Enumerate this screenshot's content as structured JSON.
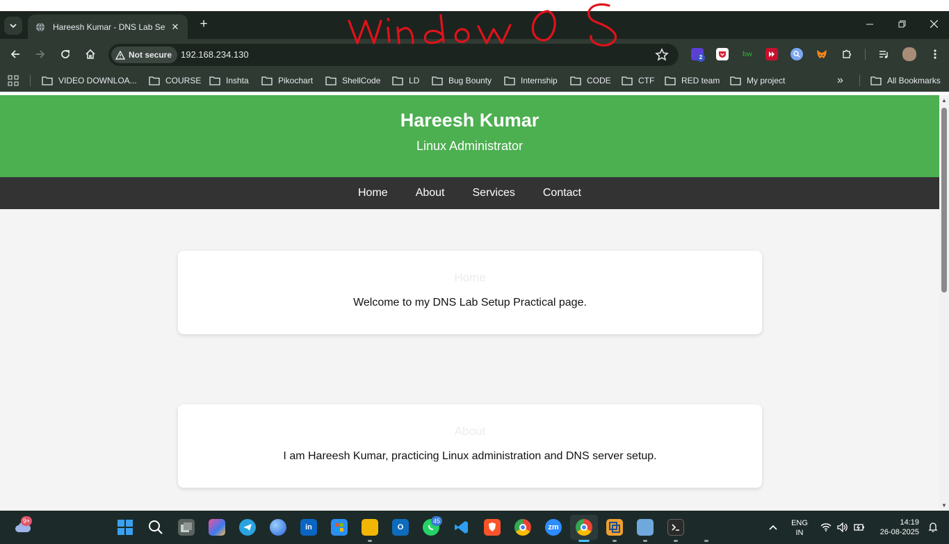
{
  "browser": {
    "tab_title": "Hareesh Kumar - DNS Lab Setup",
    "new_tab_symbol": "+",
    "close_tab_symbol": "✕",
    "security_label": "Not secure",
    "url": "192.168.234.130",
    "extension_badge": "2",
    "extension_text": "bw"
  },
  "annotation": {
    "text": "window OS",
    "color": "#e0121b"
  },
  "bookmarks": {
    "items": [
      "VIDEO DOWNLOA...",
      "COURSE",
      "Inshta",
      "Pikochart",
      "ShellCode",
      "LD",
      "Bug Bounty",
      "Internship",
      "CODE",
      "CTF",
      "RED team",
      "My project"
    ],
    "more_symbol": "»",
    "all_bookmarks": "All Bookmarks"
  },
  "site": {
    "title": "Hareesh Kumar",
    "subtitle": "Linux Administrator",
    "nav": [
      "Home",
      "About",
      "Services",
      "Contact"
    ],
    "sections": [
      {
        "heading": "Home",
        "text": "Welcome to my DNS Lab Setup Practical page."
      },
      {
        "heading": "About",
        "text": "I am Hareesh Kumar, practicing Linux administration and DNS server setup."
      }
    ],
    "colors": {
      "header": "#4caf50",
      "nav": "#333333",
      "background": "#f4f4f4"
    }
  },
  "taskbar": {
    "weather_badge": "9+",
    "whatsapp_badge": "45",
    "language": "ENG",
    "region": "IN",
    "time": "14:19",
    "date": "26-08-2025",
    "zoom_label": "zm"
  }
}
